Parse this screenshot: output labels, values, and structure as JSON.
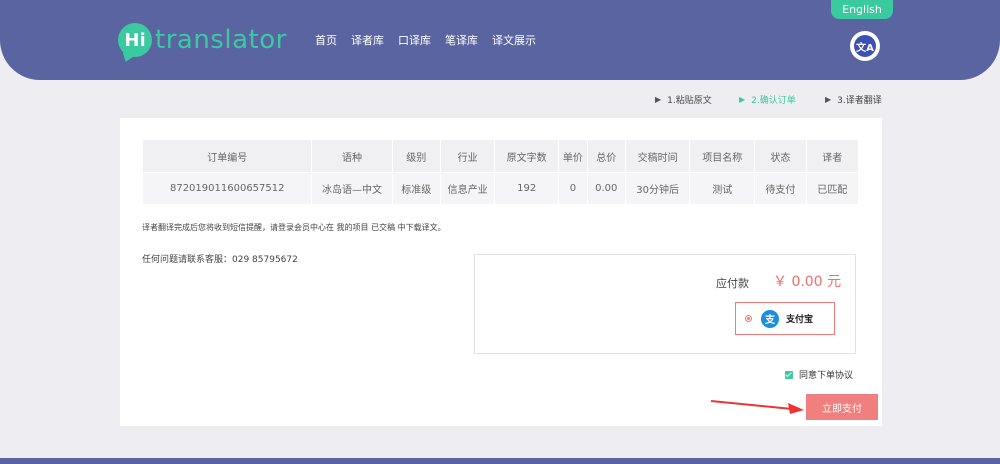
{
  "header": {
    "logo_hi": "Hi",
    "logo_text": "translator",
    "nav": [
      "首页",
      "译者库",
      "口译库",
      "笔译库",
      "译文展示"
    ],
    "lang_button": "English",
    "translate_icon_glyph": "文A"
  },
  "steps": [
    {
      "label": "1.粘贴原文",
      "active": false
    },
    {
      "label": "2.确认订单",
      "active": true
    },
    {
      "label": "3.译者翻译",
      "active": false
    }
  ],
  "order_table": {
    "headers": [
      "订单编号",
      "语种",
      "级别",
      "行业",
      "原文字数",
      "单价",
      "总价",
      "交稿时间",
      "项目名称",
      "状态",
      "译者"
    ],
    "rows": [
      [
        "872019011600657512",
        "冰岛语—中文",
        "标准级",
        "信息产业",
        "192",
        "0",
        "0.00",
        "30分钟后",
        "测试",
        "待支付",
        "已匹配"
      ]
    ]
  },
  "notes": {
    "notice": "译者翻译完成后您将收到短信提醒，请登录会员中心在 我的项目 已交稿 中下载译文。",
    "contact": "任何问题请联系客服：029 85795672"
  },
  "payment": {
    "amount_label": "应付款",
    "amount_value": "￥ 0.00 元",
    "method_label": "支付宝",
    "method_icon_glyph": "支"
  },
  "agree_label": "同意下单协议",
  "submit_label": "立即支付",
  "colors": {
    "header_bg": "#5a64a0",
    "accent_green": "#3bc9a0",
    "price_red": "#f26c6c",
    "alipay_blue": "#1a8fe0"
  }
}
